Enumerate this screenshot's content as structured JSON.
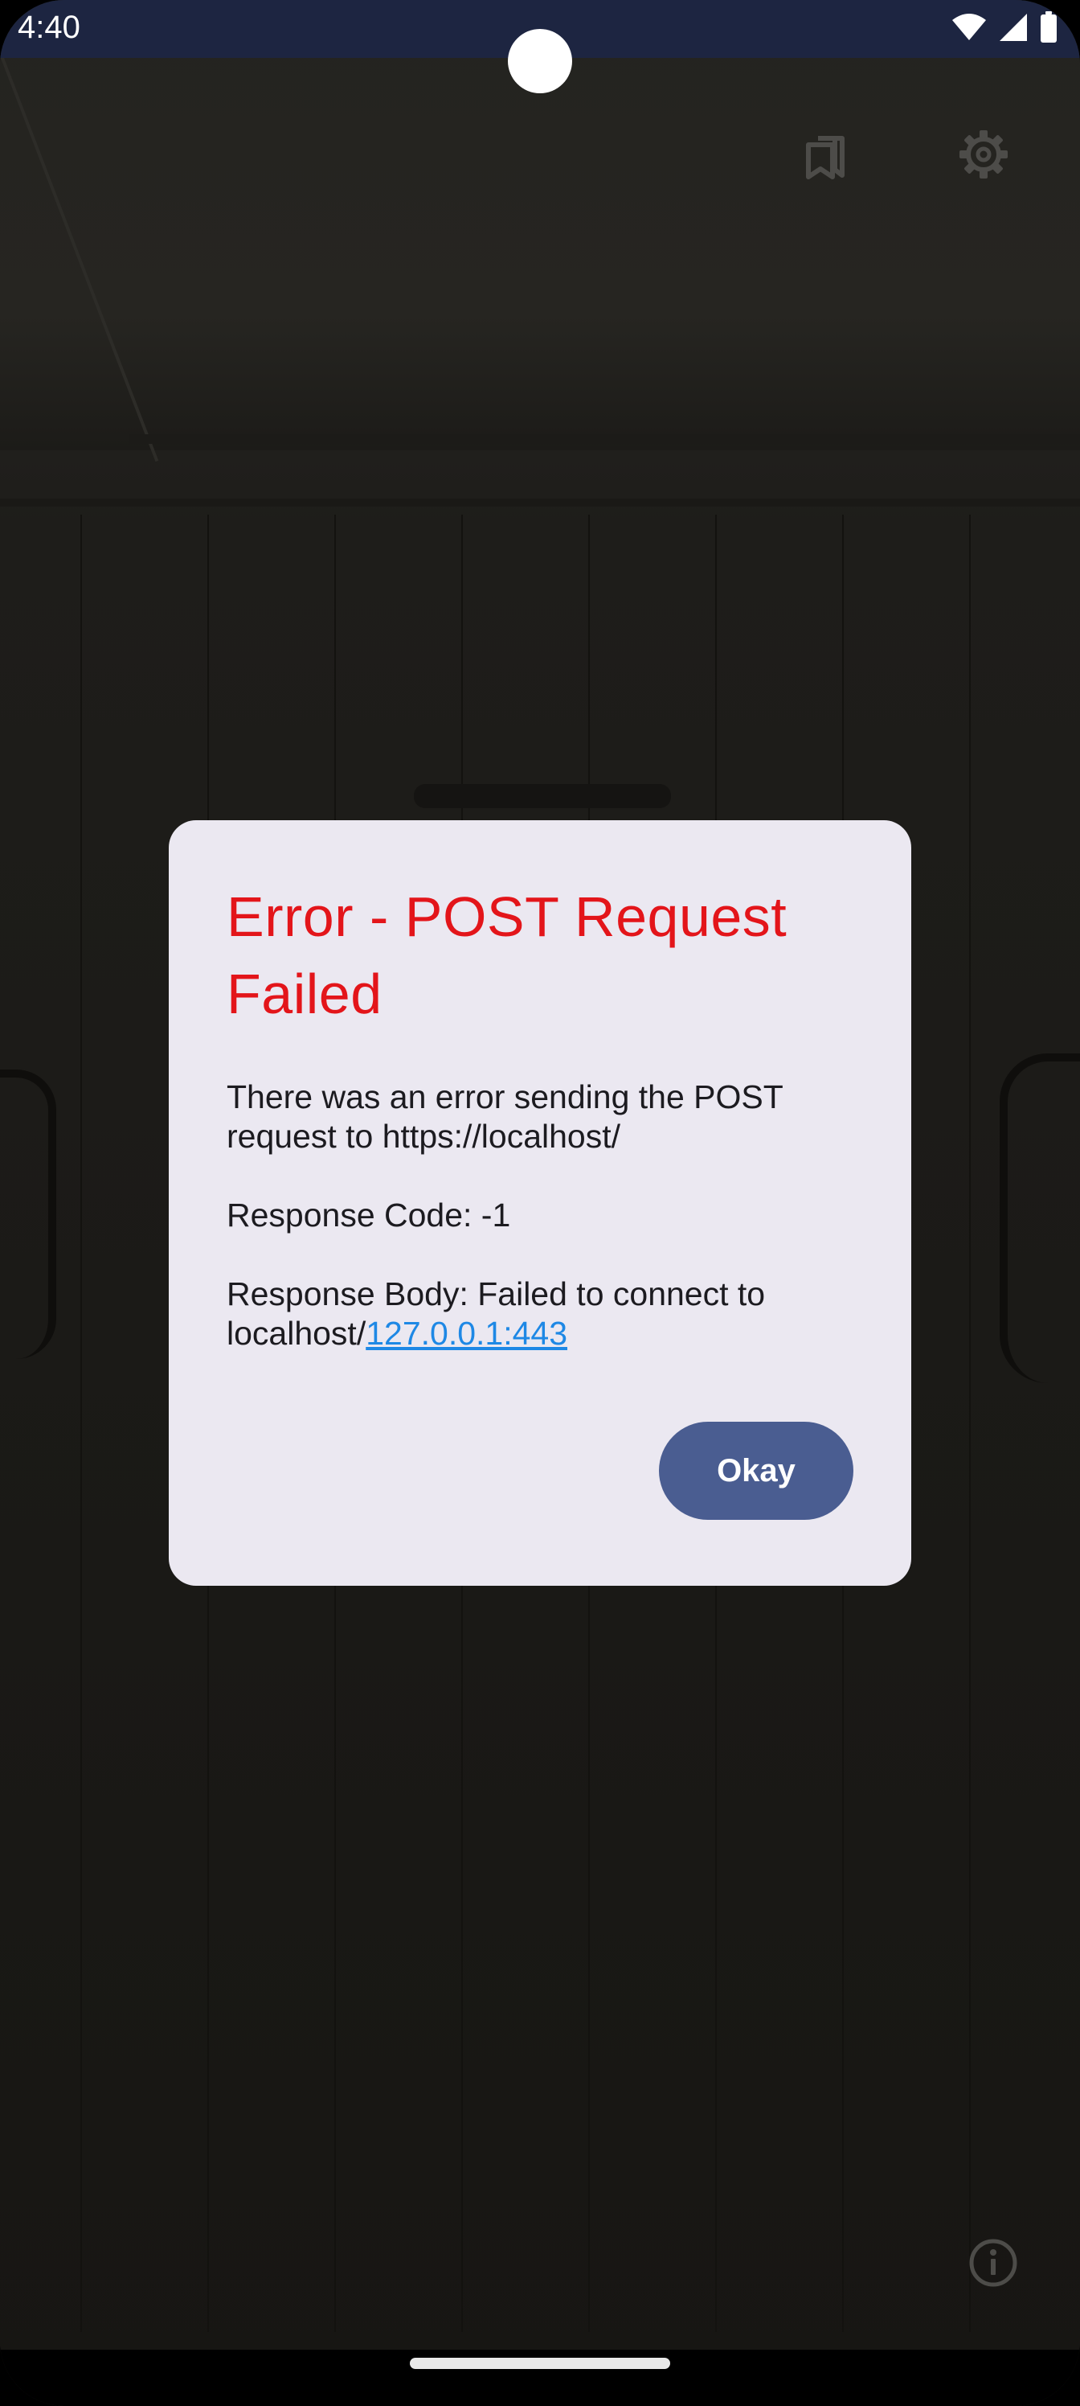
{
  "status_bar": {
    "time": "4:40",
    "icons": [
      "wifi-icon",
      "cellular-signal-icon",
      "battery-icon"
    ]
  },
  "top_bar": {
    "icons": [
      "bookmarks-icon",
      "settings-gear-icon"
    ]
  },
  "dialog": {
    "title": "Error - POST Request Failed",
    "message_line": "There was an error sending the POST request to https://localhost/",
    "response_code": "Response Code: -1",
    "response_body_prefix": "Response Body: Failed to connect to localhost/",
    "response_body_link": "127.0.0.1:443",
    "okay_label": "Okay",
    "colors": {
      "title": "#e3151a",
      "button": "#4a5d91",
      "link": "#1e88e5",
      "background": "#ebe8f1"
    }
  },
  "bottom": {
    "info_icon": "info-icon"
  }
}
